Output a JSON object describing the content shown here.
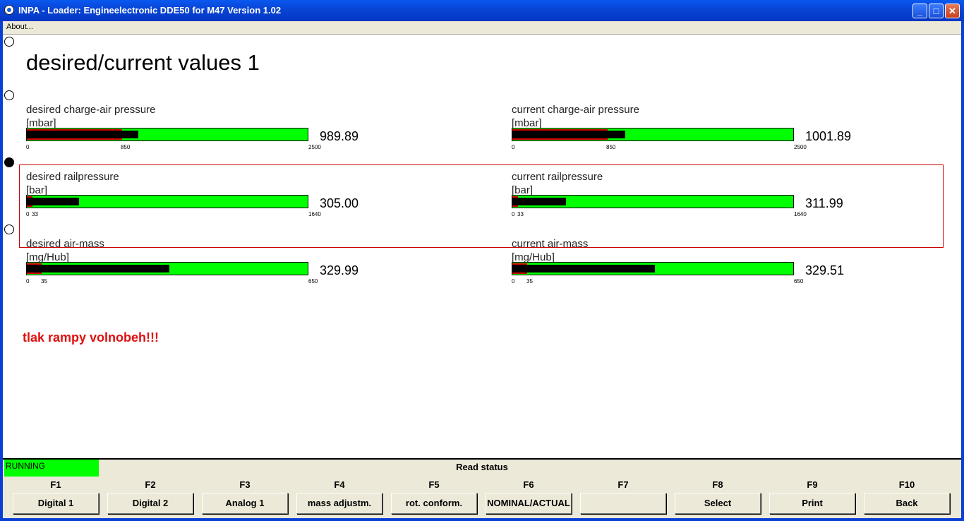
{
  "window": {
    "title": "INPA - Loader:  Engineelectronic DDE50 for M47 Version 1.02",
    "min_label": "_",
    "max_label": "□",
    "close_label": "✕"
  },
  "menu": {
    "about": "About..."
  },
  "page": {
    "title": "desired/current values 1",
    "message": "tlak rampy volnobeh!!!"
  },
  "gauges": {
    "desired_charge": {
      "label": "desired charge-air pressure",
      "unit": "[mbar]",
      "value": "989.89",
      "min": 0,
      "max": 2500,
      "mark": 850,
      "t0": "0",
      "t1": "850",
      "t2": "2500"
    },
    "current_charge": {
      "label": "current charge-air pressure",
      "unit": "[mbar]",
      "value": "1001.89",
      "min": 0,
      "max": 2500,
      "mark": 850,
      "t0": "0",
      "t1": "850",
      "t2": "2500"
    },
    "desired_rail": {
      "label": "desired railpressure",
      "unit": "[bar]",
      "value": "305.00",
      "min": 0,
      "max": 1640,
      "mark": 33,
      "t0": "0",
      "t1": "33",
      "t2": "1640"
    },
    "current_rail": {
      "label": "current railpressure",
      "unit": "[bar]",
      "value": "311.99",
      "min": 0,
      "max": 1640,
      "mark": 33,
      "t0": "0",
      "t1": "33",
      "t2": "1640"
    },
    "desired_air": {
      "label": "desired air-mass",
      "unit": "[mg/Hub]",
      "value": "329.99",
      "min": 0,
      "max": 650,
      "mark": 35,
      "t0": "0",
      "t1": "35",
      "t2": "650"
    },
    "current_air": {
      "label": "current air-mass",
      "unit": "[mg/Hub]",
      "value": "329.51",
      "min": 0,
      "max": 650,
      "mark": 35,
      "t0": "0",
      "t1": "35",
      "t2": "650"
    }
  },
  "status": {
    "running": "RUNNING",
    "read_status": "Read status",
    "running_color": "#00ff00"
  },
  "fkeys": [
    {
      "key": "F1",
      "label": "Digital 1"
    },
    {
      "key": "F2",
      "label": "Digital 2"
    },
    {
      "key": "F3",
      "label": "Analog 1"
    },
    {
      "key": "F4",
      "label": "mass adjustm."
    },
    {
      "key": "F5",
      "label": "rot. conform."
    },
    {
      "key": "F6",
      "label": "NOMINAL/ACTUAL"
    },
    {
      "key": "F7",
      "label": ""
    },
    {
      "key": "F8",
      "label": "Select"
    },
    {
      "key": "F9",
      "label": "Print"
    },
    {
      "key": "F10",
      "label": "Back"
    }
  ]
}
